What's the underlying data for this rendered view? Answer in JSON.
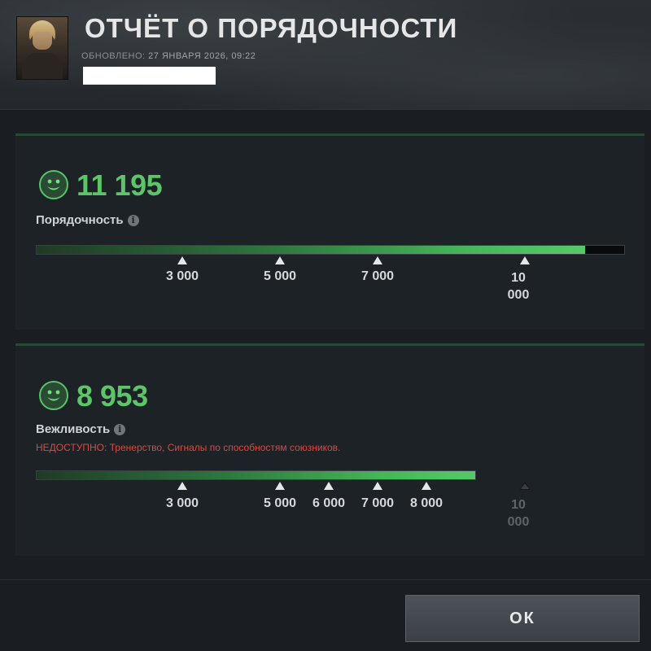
{
  "header": {
    "title": "ОТЧЁТ О ПОРЯДОЧНОСТИ",
    "updated_label": "ОБНОВЛЕНО:",
    "updated_value": "27 ЯНВАРЯ 2026, 09:22"
  },
  "conduct": {
    "score": "11 195",
    "label": "Порядочность",
    "info_icon": "i",
    "progress_fraction": 0.933,
    "ticks": [
      {
        "label": "3 000",
        "value": 3000
      },
      {
        "label": "5 000",
        "value": 5000
      },
      {
        "label": "7 000",
        "value": 7000
      },
      {
        "label": "10 000",
        "value": 10000
      }
    ]
  },
  "behavior": {
    "score": "8 953",
    "label": "Вежливость",
    "info_icon": "i",
    "warning": "НЕДОСТУПНО:  Тренерство, Сигналы по способностям союзников.",
    "progress_fraction": 0.746,
    "ticks": [
      {
        "label": "3 000",
        "value": 3000
      },
      {
        "label": "5 000",
        "value": 5000
      },
      {
        "label": "6 000",
        "value": 6000
      },
      {
        "label": "7 000",
        "value": 7000
      },
      {
        "label": "8 000",
        "value": 8000
      },
      {
        "label": "10 000",
        "value": 10000
      }
    ]
  },
  "colors": {
    "score_green": "#5ec46a",
    "warning_red": "#d84a3f"
  },
  "icons": {
    "smile": "smile-face-icon",
    "info": "info-icon",
    "avatar": "avatar"
  },
  "footer": {
    "ok_label": "ОК"
  }
}
